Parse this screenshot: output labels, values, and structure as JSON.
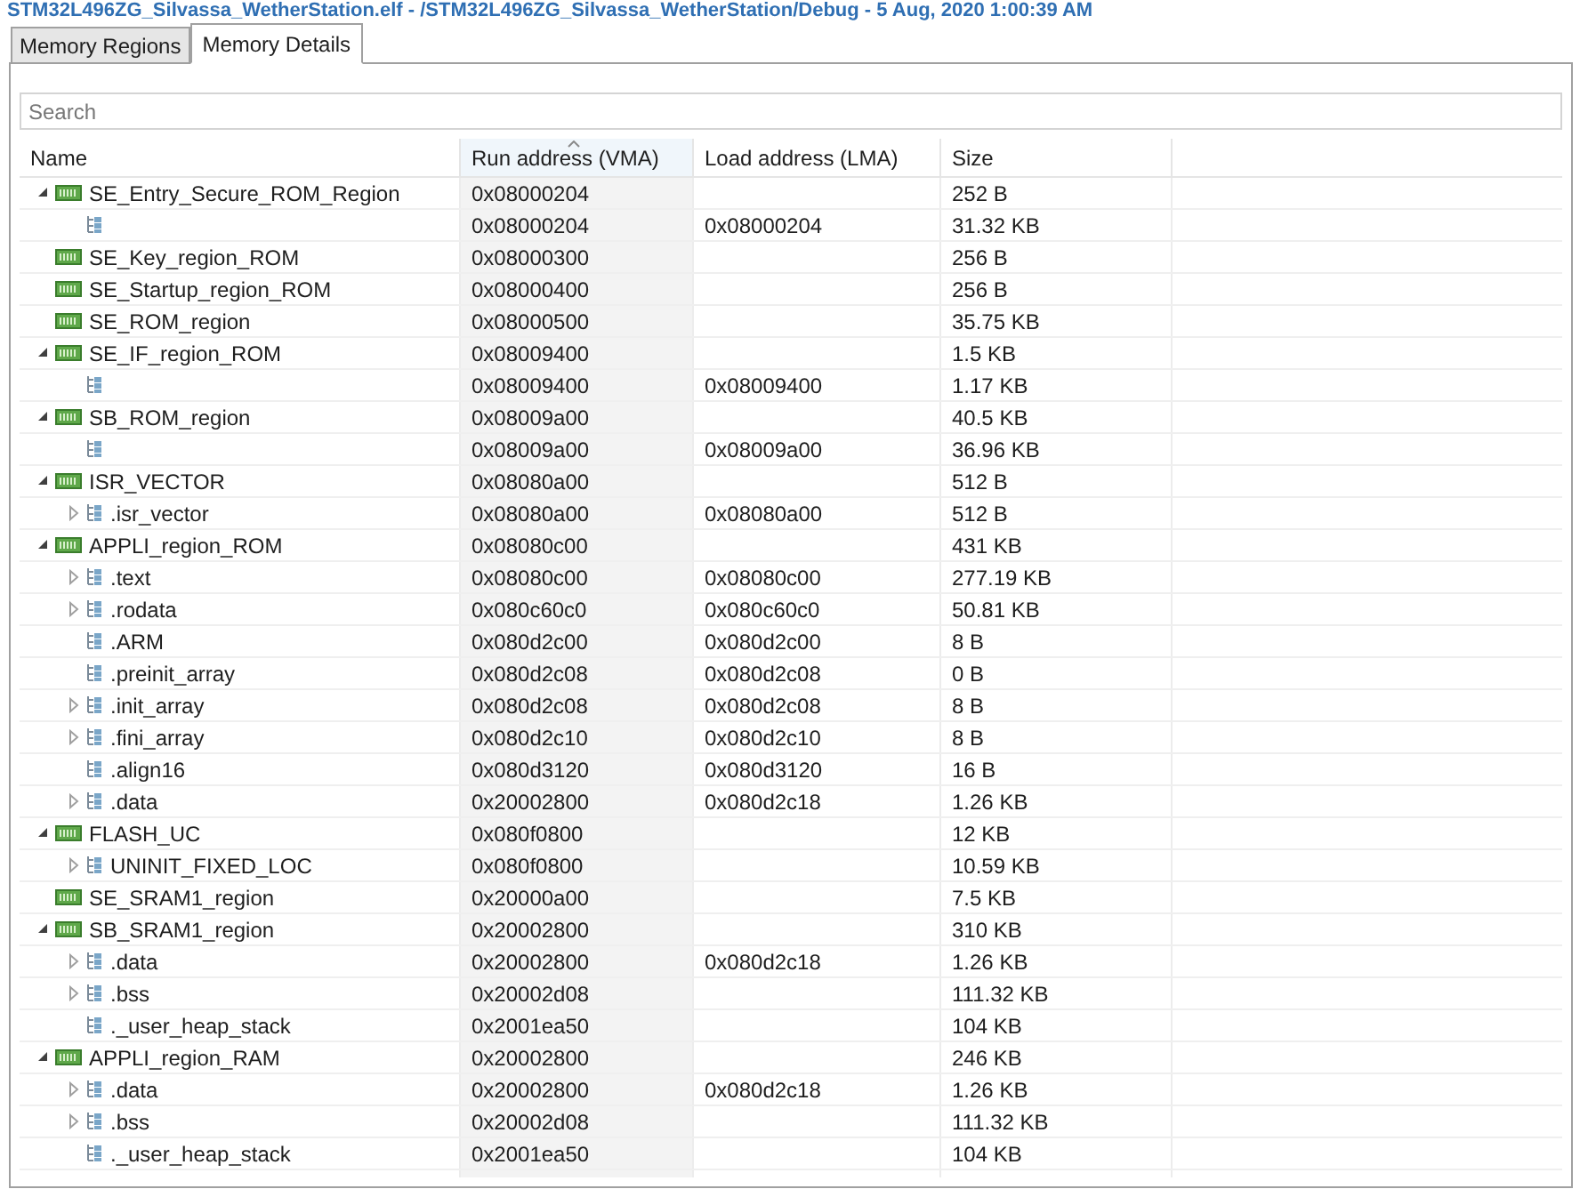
{
  "window": {
    "title": "STM32L496ZG_Silvassa_WetherStation.elf - /STM32L496ZG_Silvassa_WetherStation/Debug - 5 Aug, 2020 1:00:39 AM"
  },
  "tabs": [
    {
      "label": "Memory Regions",
      "selected": false
    },
    {
      "label": "Memory Details",
      "selected": true
    }
  ],
  "search": {
    "placeholder": "Search"
  },
  "table": {
    "columns": [
      {
        "label": "Name",
        "sorted": false
      },
      {
        "label": "Run address (VMA)",
        "sorted": true
      },
      {
        "label": "Load address (LMA)",
        "sorted": false
      },
      {
        "label": "Size",
        "sorted": false
      }
    ],
    "rows": [
      {
        "kind": "region",
        "name": "SE_Entry_Secure_ROM_Region",
        "run": "0x08000204",
        "size": "252 B",
        "expanded": true,
        "children": [
          {
            "kind": "section",
            "run": "0x08000204",
            "load": "0x08000204",
            "size": "31.32 KB"
          }
        ]
      },
      {
        "kind": "region",
        "name": "SE_Key_region_ROM",
        "run": "0x08000300",
        "size": "256 B"
      },
      {
        "kind": "region",
        "name": "SE_Startup_region_ROM",
        "run": "0x08000400",
        "size": "256 B"
      },
      {
        "kind": "region",
        "name": "SE_ROM_region",
        "run": "0x08000500",
        "size": "35.75 KB"
      },
      {
        "kind": "region",
        "name": "SE_IF_region_ROM",
        "run": "0x08009400",
        "size": "1.5 KB",
        "expanded": true,
        "children": [
          {
            "kind": "section",
            "run": "0x08009400",
            "load": "0x08009400",
            "size": "1.17 KB"
          }
        ]
      },
      {
        "kind": "region",
        "name": "SB_ROM_region",
        "run": "0x08009a00",
        "size": "40.5 KB",
        "expanded": true,
        "children": [
          {
            "kind": "section",
            "run": "0x08009a00",
            "load": "0x08009a00",
            "size": "36.96 KB"
          }
        ]
      },
      {
        "kind": "region",
        "name": "ISR_VECTOR",
        "run": "0x08080a00",
        "size": "512 B",
        "expanded": true,
        "children": [
          {
            "kind": "section",
            "name": ".isr_vector",
            "run": "0x08080a00",
            "load": "0x08080a00",
            "size": "512 B",
            "expanded": false
          }
        ]
      },
      {
        "kind": "region",
        "name": "APPLI_region_ROM",
        "run": "0x08080c00",
        "size": "431 KB",
        "expanded": true,
        "children": [
          {
            "kind": "section",
            "name": ".text",
            "run": "0x08080c00",
            "load": "0x08080c00",
            "size": "277.19 KB",
            "expanded": false
          },
          {
            "kind": "section",
            "name": ".rodata",
            "run": "0x080c60c0",
            "load": "0x080c60c0",
            "size": "50.81 KB",
            "expanded": false
          },
          {
            "kind": "section",
            "name": ".ARM",
            "run": "0x080d2c00",
            "load": "0x080d2c00",
            "size": "8 B"
          },
          {
            "kind": "section",
            "name": ".preinit_array",
            "run": "0x080d2c08",
            "load": "0x080d2c08",
            "size": "0 B"
          },
          {
            "kind": "section",
            "name": ".init_array",
            "run": "0x080d2c08",
            "load": "0x080d2c08",
            "size": "8 B",
            "expanded": false
          },
          {
            "kind": "section",
            "name": ".fini_array",
            "run": "0x080d2c10",
            "load": "0x080d2c10",
            "size": "8 B",
            "expanded": false
          },
          {
            "kind": "section",
            "name": ".align16",
            "run": "0x080d3120",
            "load": "0x080d3120",
            "size": "16 B"
          },
          {
            "kind": "section",
            "name": ".data",
            "run": "0x20002800",
            "load": "0x080d2c18",
            "size": "1.26 KB",
            "expanded": false
          }
        ]
      },
      {
        "kind": "region",
        "name": "FLASH_UC",
        "run": "0x080f0800",
        "size": "12 KB",
        "expanded": true,
        "children": [
          {
            "kind": "section",
            "name": "UNINIT_FIXED_LOC",
            "run": "0x080f0800",
            "size": "10.59 KB",
            "expanded": false
          }
        ]
      },
      {
        "kind": "region",
        "name": "SE_SRAM1_region",
        "run": "0x20000a00",
        "size": "7.5 KB"
      },
      {
        "kind": "region",
        "name": "SB_SRAM1_region",
        "run": "0x20002800",
        "size": "310 KB",
        "expanded": true,
        "children": [
          {
            "kind": "section",
            "name": ".data",
            "run": "0x20002800",
            "load": "0x080d2c18",
            "size": "1.26 KB",
            "expanded": false
          },
          {
            "kind": "section",
            "name": ".bss",
            "run": "0x20002d08",
            "size": "111.32 KB",
            "expanded": false
          },
          {
            "kind": "section",
            "name": "._user_heap_stack",
            "run": "0x2001ea50",
            "size": "104 KB"
          }
        ]
      },
      {
        "kind": "region",
        "name": "APPLI_region_RAM",
        "run": "0x20002800",
        "size": "246 KB",
        "expanded": true,
        "children": [
          {
            "kind": "section",
            "name": ".data",
            "run": "0x20002800",
            "load": "0x080d2c18",
            "size": "1.26 KB",
            "expanded": false
          },
          {
            "kind": "section",
            "name": ".bss",
            "run": "0x20002d08",
            "size": "111.32 KB",
            "expanded": false
          },
          {
            "kind": "section",
            "name": "._user_heap_stack",
            "run": "0x2001ea50",
            "size": "104 KB"
          }
        ]
      }
    ]
  }
}
